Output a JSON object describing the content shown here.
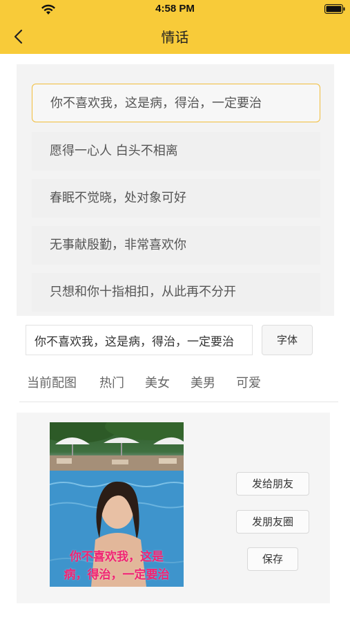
{
  "status_bar": {
    "time": "4:58 PM"
  },
  "header": {
    "title": "情话",
    "accent_color": "#f8cb39"
  },
  "phrases": [
    {
      "text": "你不喜欢我，这是病，得治，一定要治",
      "selected": true
    },
    {
      "text": "愿得一心人 白头不相离",
      "selected": false
    },
    {
      "text": "春眠不觉晓，处对象可好",
      "selected": false
    },
    {
      "text": "无事献殷勤，非常喜欢你",
      "selected": false
    },
    {
      "text": "只想和你十指相扣，从此再不分开",
      "selected": false
    }
  ],
  "input": {
    "value": "你不喜欢我，这是病，得治，一定要治"
  },
  "font_button": "字体",
  "tabs": [
    "当前配图",
    "热门",
    "美女",
    "美男",
    "可爱"
  ],
  "preview": {
    "caption_line1": "你不喜欢我，这是",
    "caption_line2": "病，得治，一定要治"
  },
  "actions": {
    "send_friend": "发给朋友",
    "moments": "发朋友圈",
    "save": "保存"
  }
}
